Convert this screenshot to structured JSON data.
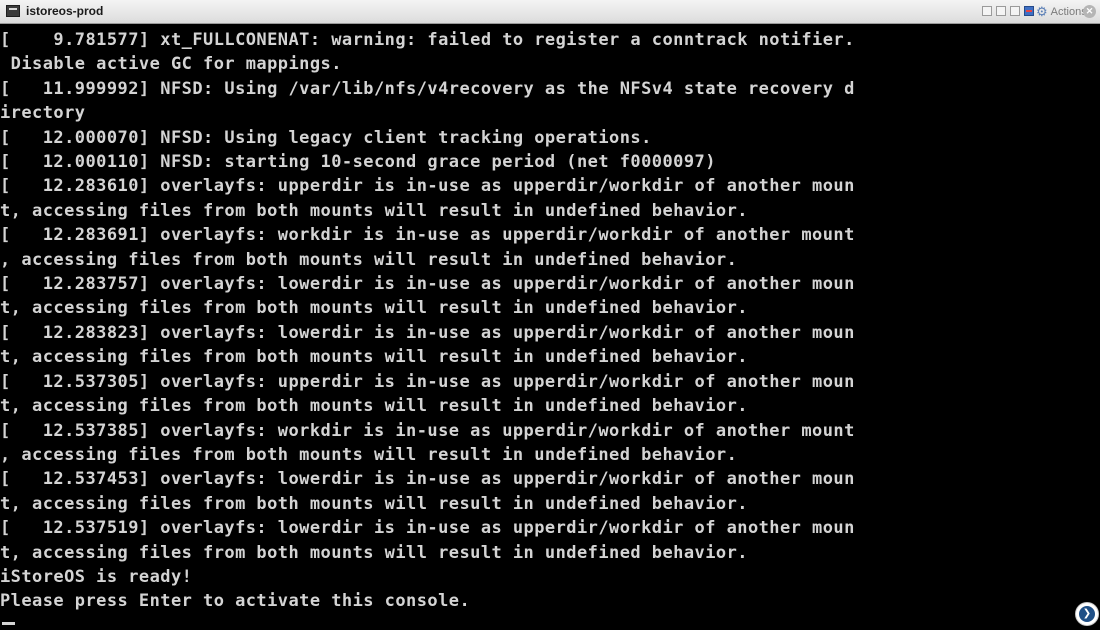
{
  "window": {
    "title": "istoreos-prod",
    "actions_label": "Actions",
    "close_glyph": "✕",
    "app_icon": "terminal-icon"
  },
  "console": {
    "lines": [
      "[    9.781577] xt_FULLCONENAT: warning: failed to register a conntrack notifier.",
      " Disable active GC for mappings.",
      "[   11.999992] NFSD: Using /var/lib/nfs/v4recovery as the NFSv4 state recovery d",
      "irectory",
      "[   12.000070] NFSD: Using legacy client tracking operations.",
      "[   12.000110] NFSD: starting 10-second grace period (net f0000097)",
      "[   12.283610] overlayfs: upperdir is in-use as upperdir/workdir of another moun",
      "t, accessing files from both mounts will result in undefined behavior.",
      "[   12.283691] overlayfs: workdir is in-use as upperdir/workdir of another mount",
      ", accessing files from both mounts will result in undefined behavior.",
      "[   12.283757] overlayfs: lowerdir is in-use as upperdir/workdir of another moun",
      "t, accessing files from both mounts will result in undefined behavior.",
      "[   12.283823] overlayfs: lowerdir is in-use as upperdir/workdir of another moun",
      "t, accessing files from both mounts will result in undefined behavior.",
      "[   12.537305] overlayfs: upperdir is in-use as upperdir/workdir of another moun",
      "t, accessing files from both mounts will result in undefined behavior.",
      "[   12.537385] overlayfs: workdir is in-use as upperdir/workdir of another mount",
      ", accessing files from both mounts will result in undefined behavior.",
      "[   12.537453] overlayfs: lowerdir is in-use as upperdir/workdir of another moun",
      "t, accessing files from both mounts will result in undefined behavior.",
      "[   12.537519] overlayfs: lowerdir is in-use as upperdir/workdir of another moun",
      "t, accessing files from both mounts will result in undefined behavior.",
      "iStoreOS is ready!",
      "Please press Enter to activate this console."
    ]
  },
  "colors": {
    "console_bg": "#000000",
    "console_fg": "#d4d4d4",
    "accent": "#1f4f86"
  }
}
